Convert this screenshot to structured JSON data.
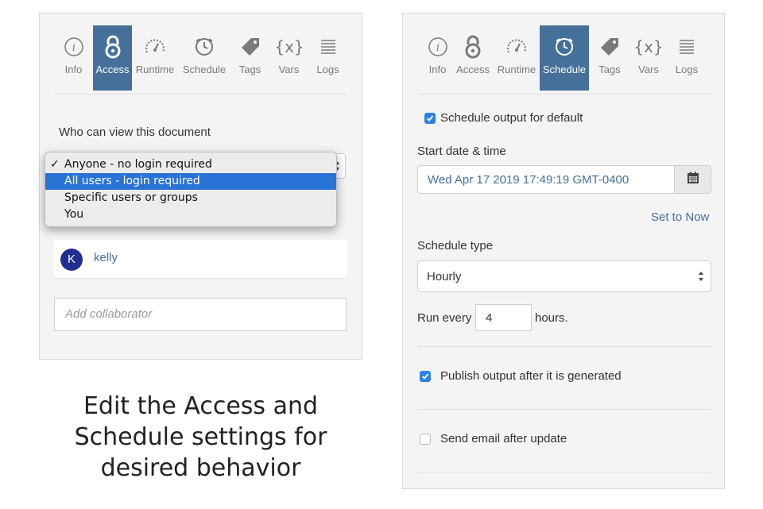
{
  "left": {
    "tabs": [
      {
        "label": "Info",
        "icon": "info-icon"
      },
      {
        "label": "Access",
        "icon": "lock-icon",
        "active": true
      },
      {
        "label": "Runtime",
        "icon": "gauge-icon"
      },
      {
        "label": "Schedule",
        "icon": "clock-icon"
      },
      {
        "label": "Tags",
        "icon": "tag-icon"
      },
      {
        "label": "Vars",
        "icon": "braces-icon"
      },
      {
        "label": "Logs",
        "icon": "lines-icon"
      }
    ],
    "who_label": "Who can view this document",
    "dropdown": {
      "options": [
        "Anyone - no login required",
        "All users - login required",
        "Specific users or groups",
        "You"
      ],
      "checked": "Anyone - no login required",
      "highlighted": "All users - login required"
    },
    "collaborator": {
      "initial": "K",
      "name": "kelly",
      "avatar_color": "#1f2f8f"
    },
    "add_collaborator_placeholder": "Add collaborator"
  },
  "right": {
    "tabs": [
      {
        "label": "Info",
        "icon": "info-icon"
      },
      {
        "label": "Access",
        "icon": "lock-icon"
      },
      {
        "label": "Runtime",
        "icon": "gauge-icon"
      },
      {
        "label": "Schedule",
        "icon": "clock-icon",
        "active": true
      },
      {
        "label": "Tags",
        "icon": "tag-icon"
      },
      {
        "label": "Vars",
        "icon": "braces-icon"
      },
      {
        "label": "Logs",
        "icon": "lines-icon"
      }
    ],
    "schedule_output_label": "Schedule output for default",
    "schedule_output_checked": true,
    "start_label": "Start date & time",
    "start_value": "Wed Apr 17 2019 17:49:19 GMT-0400",
    "set_to_now": "Set to Now",
    "schedule_type_label": "Schedule type",
    "schedule_type_value": "Hourly",
    "run_every_label": "Run every",
    "run_every_value": "4",
    "run_every_unit": "hours.",
    "publish_label": "Publish output after it is generated",
    "publish_checked": true,
    "email_label": "Send email after update",
    "email_checked": false
  },
  "caption": "Edit the Access and\nSchedule settings for\ndesired behavior",
  "colors": {
    "accent": "#447099",
    "checkbox": "#2b82e6",
    "highlight": "#2a73d6"
  }
}
